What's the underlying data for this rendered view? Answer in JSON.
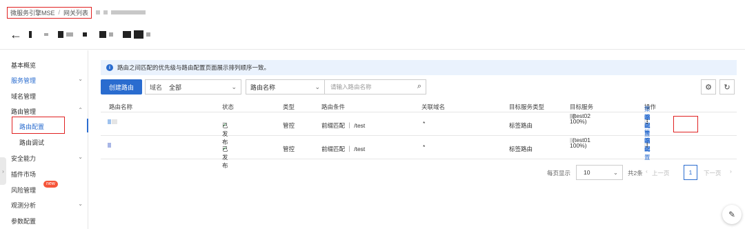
{
  "breadcrumb": {
    "root": "微服务引擎MSE",
    "separator": "/",
    "current": "网关列表"
  },
  "header": {
    "back_icon": "arrow-left-icon"
  },
  "sidebar": {
    "items": [
      {
        "label": "基本概览"
      },
      {
        "label": "服务管理"
      },
      {
        "label": "域名管理"
      },
      {
        "label": "路由管理"
      },
      {
        "label": "路由配置"
      },
      {
        "label": "路由调试"
      },
      {
        "label": "安全能力"
      },
      {
        "label": "插件市场"
      },
      {
        "label": "风险管理",
        "badge": "new"
      },
      {
        "label": "观测分析"
      },
      {
        "label": "参数配置"
      }
    ]
  },
  "notice": {
    "text": "路由之间匹配的优先级与路由配置页面展示排列顺序一致。"
  },
  "toolbar": {
    "create_label": "创建路由",
    "domain_label": "域名",
    "domain_value": "全部",
    "filter_field": "路由名称",
    "search_placeholder": "请输入路由名称"
  },
  "table": {
    "headers": [
      "路由名称",
      "状态",
      "类型",
      "路由条件",
      "关联域名",
      "目标服务类型",
      "目标服务",
      "操作"
    ],
    "rows": [
      {
        "status": "已发布",
        "type": "管控",
        "condition": "前缀匹配 ｜ /test",
        "domain": "*",
        "target_type": "标签路由",
        "service_suffix": "(test02",
        "service_pct": "100%)",
        "ops": [
          "策略配置",
          "编辑",
          "调试"
        ]
      },
      {
        "status": "已发布",
        "type": "管控",
        "condition": "前缀匹配 ｜ /test",
        "domain": "*",
        "target_type": "标签路由",
        "service_suffix": "(test01",
        "service_pct": "100%)",
        "ops": [
          "策略配置",
          "编辑",
          "调试"
        ]
      }
    ]
  },
  "pager": {
    "per_page_label": "每页显示",
    "per_page_value": "10",
    "total": "共2条",
    "prev": "上一页",
    "current": "1",
    "next": "下一页"
  },
  "colors": {
    "accent": "#2a6ccf",
    "highlight_box": "#e02020",
    "success": "#2ba245",
    "badge": "#f5553a"
  }
}
